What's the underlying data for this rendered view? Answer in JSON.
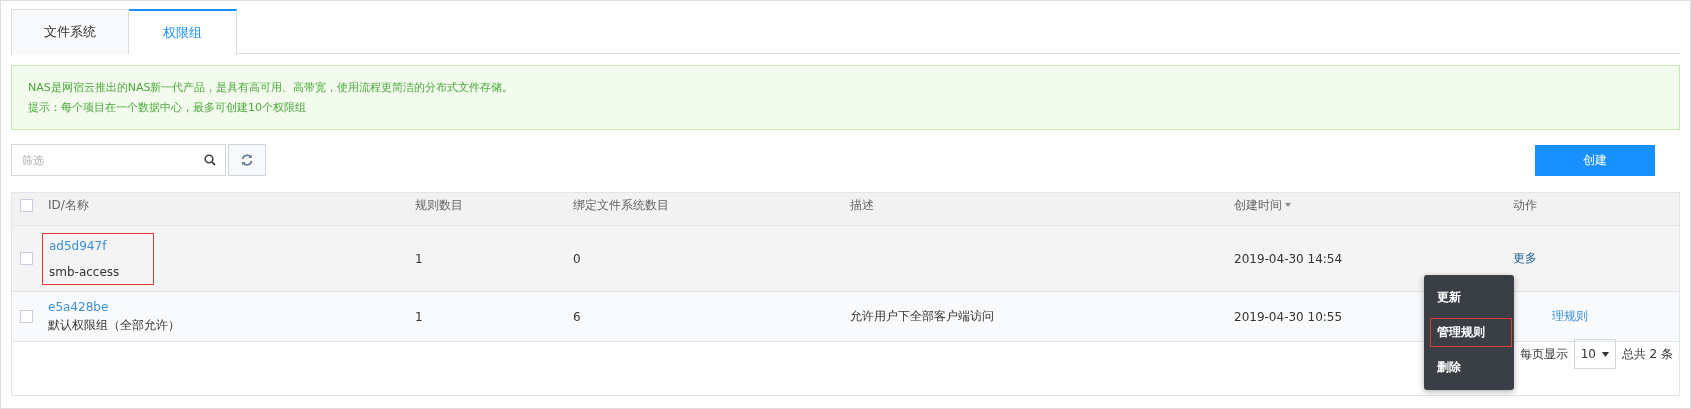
{
  "tabs": [
    {
      "label": "文件系统",
      "selected": false
    },
    {
      "label": "权限组",
      "selected": true
    }
  ],
  "notice": {
    "lines": [
      "NAS是网宿云推出的NAS新一代产品，是具有高可用、高带宽，使用流程更简洁的分布式文件存储。",
      "提示：每个项目在一个数据中心，最多可创建10个权限组"
    ]
  },
  "toolbar": {
    "search": {
      "placeholder": "筛选"
    },
    "create_button": "创建"
  },
  "table": {
    "select_all_checked": false,
    "columns": [
      {
        "label": "ID/名称",
        "sortable": false
      },
      {
        "label": "规则数目",
        "sortable": false
      },
      {
        "label": "绑定文件系统数目",
        "sortable": false
      },
      {
        "label": "描述",
        "sortable": false
      },
      {
        "label": "创建时间",
        "sortable": true
      },
      {
        "label": "动作",
        "sortable": false
      }
    ],
    "rows": [
      {
        "id": "ad5d947f",
        "name": "smb-access",
        "rules": "1",
        "bound": "0",
        "description": "",
        "created": "2019-04-30 14:54",
        "action": "更多",
        "checked": false,
        "hovered": true,
        "highlighted": true
      },
      {
        "id": "e5a428be",
        "name": "默认权限组（全部允许）",
        "rules": "1",
        "bound": "6",
        "description": "允许用户下全部客户端访问",
        "created": "2019-04-30 10:55",
        "action": "理规则",
        "checked": false,
        "hovered": false,
        "highlighted": false
      }
    ]
  },
  "menu": {
    "items": [
      {
        "label": "更新",
        "highlighted": false
      },
      {
        "label": "管理规则",
        "highlighted": true
      },
      {
        "label": "删除",
        "highlighted": false
      }
    ]
  },
  "pager": {
    "per_page_label": "每页显示",
    "per_page": "10",
    "total": "总共 2 条"
  }
}
